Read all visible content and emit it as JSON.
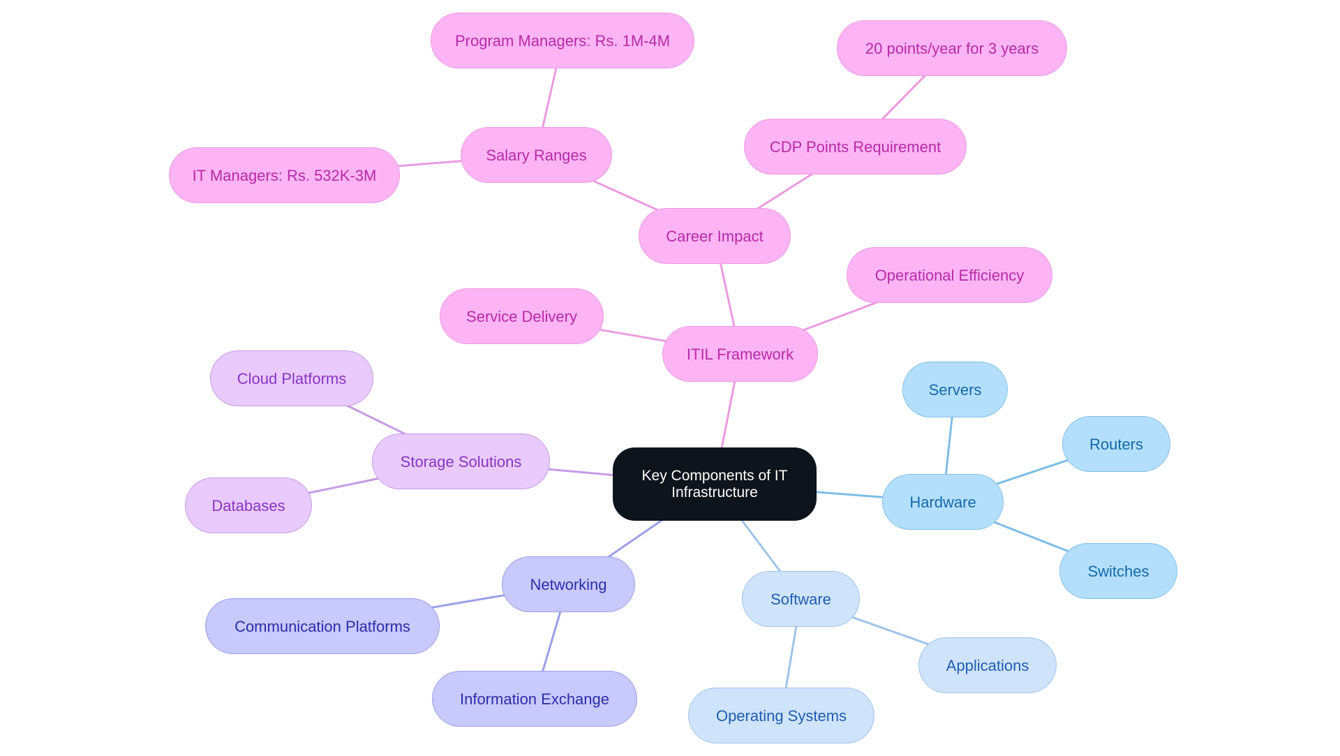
{
  "title": "Key Components of IT Infrastructure",
  "colors": {
    "root": "#0d141c",
    "pink": "#fcb4f5",
    "lilac": "#e8cbfc",
    "indigo": "#c8c9fc",
    "sky": "#cfe3fb",
    "blue": "#b3dffd",
    "edge_pink": "#eb9ae0",
    "edge_lilac": "#c79ae5",
    "edge_indigo": "#9c9ee8",
    "edge_sky": "#9fc4ea",
    "edge_blue": "#7dbde6"
  },
  "nodes": [
    {
      "id": "root",
      "label": "Key Components of IT Infrastructure",
      "theme": "root"
    },
    {
      "id": "itil",
      "label": "ITIL Framework",
      "theme": "pink",
      "parent": "root"
    },
    {
      "id": "career",
      "label": "Career Impact",
      "theme": "pink",
      "parent": "itil"
    },
    {
      "id": "salary",
      "label": "Salary Ranges",
      "theme": "pink",
      "parent": "career"
    },
    {
      "id": "program",
      "label": "Program Managers: Rs. 1M-4M",
      "theme": "pink",
      "parent": "salary"
    },
    {
      "id": "itmgr",
      "label": "IT Managers: Rs. 532K-3M",
      "theme": "pink",
      "parent": "salary"
    },
    {
      "id": "cdp",
      "label": "CDP Points Requirement",
      "theme": "pink",
      "parent": "career"
    },
    {
      "id": "points",
      "label": "20 points/year for 3 years",
      "theme": "pink",
      "parent": "cdp"
    },
    {
      "id": "opeff",
      "label": "Operational Efficiency",
      "theme": "pink",
      "parent": "itil"
    },
    {
      "id": "service",
      "label": "Service Delivery",
      "theme": "pink",
      "parent": "itil"
    },
    {
      "id": "storage",
      "label": "Storage Solutions",
      "theme": "lilac",
      "parent": "root"
    },
    {
      "id": "cloud",
      "label": "Cloud Platforms",
      "theme": "lilac",
      "parent": "storage"
    },
    {
      "id": "databases",
      "label": "Databases",
      "theme": "lilac",
      "parent": "storage"
    },
    {
      "id": "networking",
      "label": "Networking",
      "theme": "indigo",
      "parent": "root"
    },
    {
      "id": "comm",
      "label": "Communication Platforms",
      "theme": "indigo",
      "parent": "networking"
    },
    {
      "id": "infoex",
      "label": "Information Exchange",
      "theme": "indigo",
      "parent": "networking"
    },
    {
      "id": "software",
      "label": "Software",
      "theme": "sky",
      "parent": "root"
    },
    {
      "id": "os",
      "label": "Operating Systems",
      "theme": "sky",
      "parent": "software"
    },
    {
      "id": "apps",
      "label": "Applications",
      "theme": "sky",
      "parent": "software"
    },
    {
      "id": "hardware",
      "label": "Hardware",
      "theme": "blue",
      "parent": "root"
    },
    {
      "id": "servers",
      "label": "Servers",
      "theme": "blue",
      "parent": "hardware"
    },
    {
      "id": "routers",
      "label": "Routers",
      "theme": "blue",
      "parent": "hardware"
    },
    {
      "id": "switches",
      "label": "Switches",
      "theme": "blue",
      "parent": "hardware"
    }
  ]
}
